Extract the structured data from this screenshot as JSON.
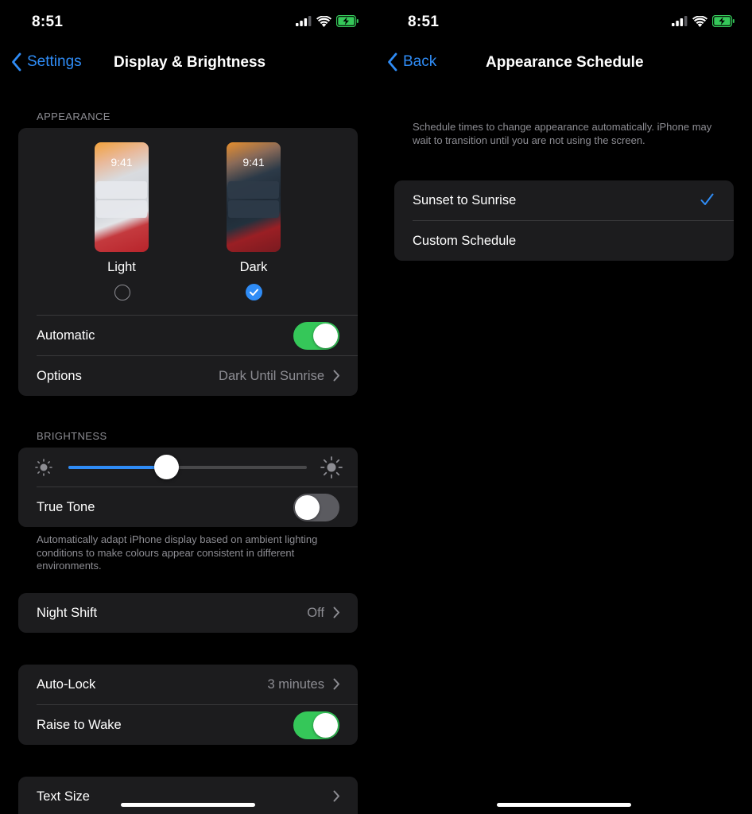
{
  "left": {
    "status": {
      "time": "8:51"
    },
    "nav": {
      "back_label": "Settings",
      "title": "Display & Brightness"
    },
    "appearance": {
      "header": "APPEARANCE",
      "light": {
        "label": "Light",
        "clock": "9:41",
        "selected": false
      },
      "dark": {
        "label": "Dark",
        "clock": "9:41",
        "selected": true
      },
      "automatic": {
        "label": "Automatic",
        "on": true
      },
      "options": {
        "label": "Options",
        "value": "Dark Until Sunrise"
      }
    },
    "brightness": {
      "header": "BRIGHTNESS",
      "level": 0.41,
      "true_tone": {
        "label": "True Tone",
        "on": false
      },
      "footer": "Automatically adapt iPhone display based on ambient lighting conditions to make colours appear consistent in different environments."
    },
    "night_shift": {
      "label": "Night Shift",
      "value": "Off"
    },
    "auto_lock": {
      "label": "Auto-Lock",
      "value": "3 minutes"
    },
    "raise_to_wake": {
      "label": "Raise to Wake",
      "on": true
    },
    "text_size": {
      "label": "Text Size"
    }
  },
  "right": {
    "status": {
      "time": "8:51"
    },
    "nav": {
      "back_label": "Back",
      "title": "Appearance Schedule"
    },
    "description": "Schedule times to change appearance automatically. iPhone may wait to transition until you are not using the screen.",
    "options": [
      {
        "label": "Sunset to Sunrise",
        "checked": true
      },
      {
        "label": "Custom Schedule",
        "checked": false
      }
    ]
  },
  "colors": {
    "accent": "#2f8cf6",
    "toggle_on": "#35c759",
    "toggle_off": "#5b5b60",
    "group_bg": "#1c1c1e",
    "secondary_text": "#8d8d93"
  },
  "icons": [
    "signal-icon",
    "wifi-icon",
    "battery-charging-icon",
    "chevron-left-icon",
    "chevron-right-icon",
    "checkmark-icon",
    "sun-small-icon",
    "sun-large-icon"
  ]
}
